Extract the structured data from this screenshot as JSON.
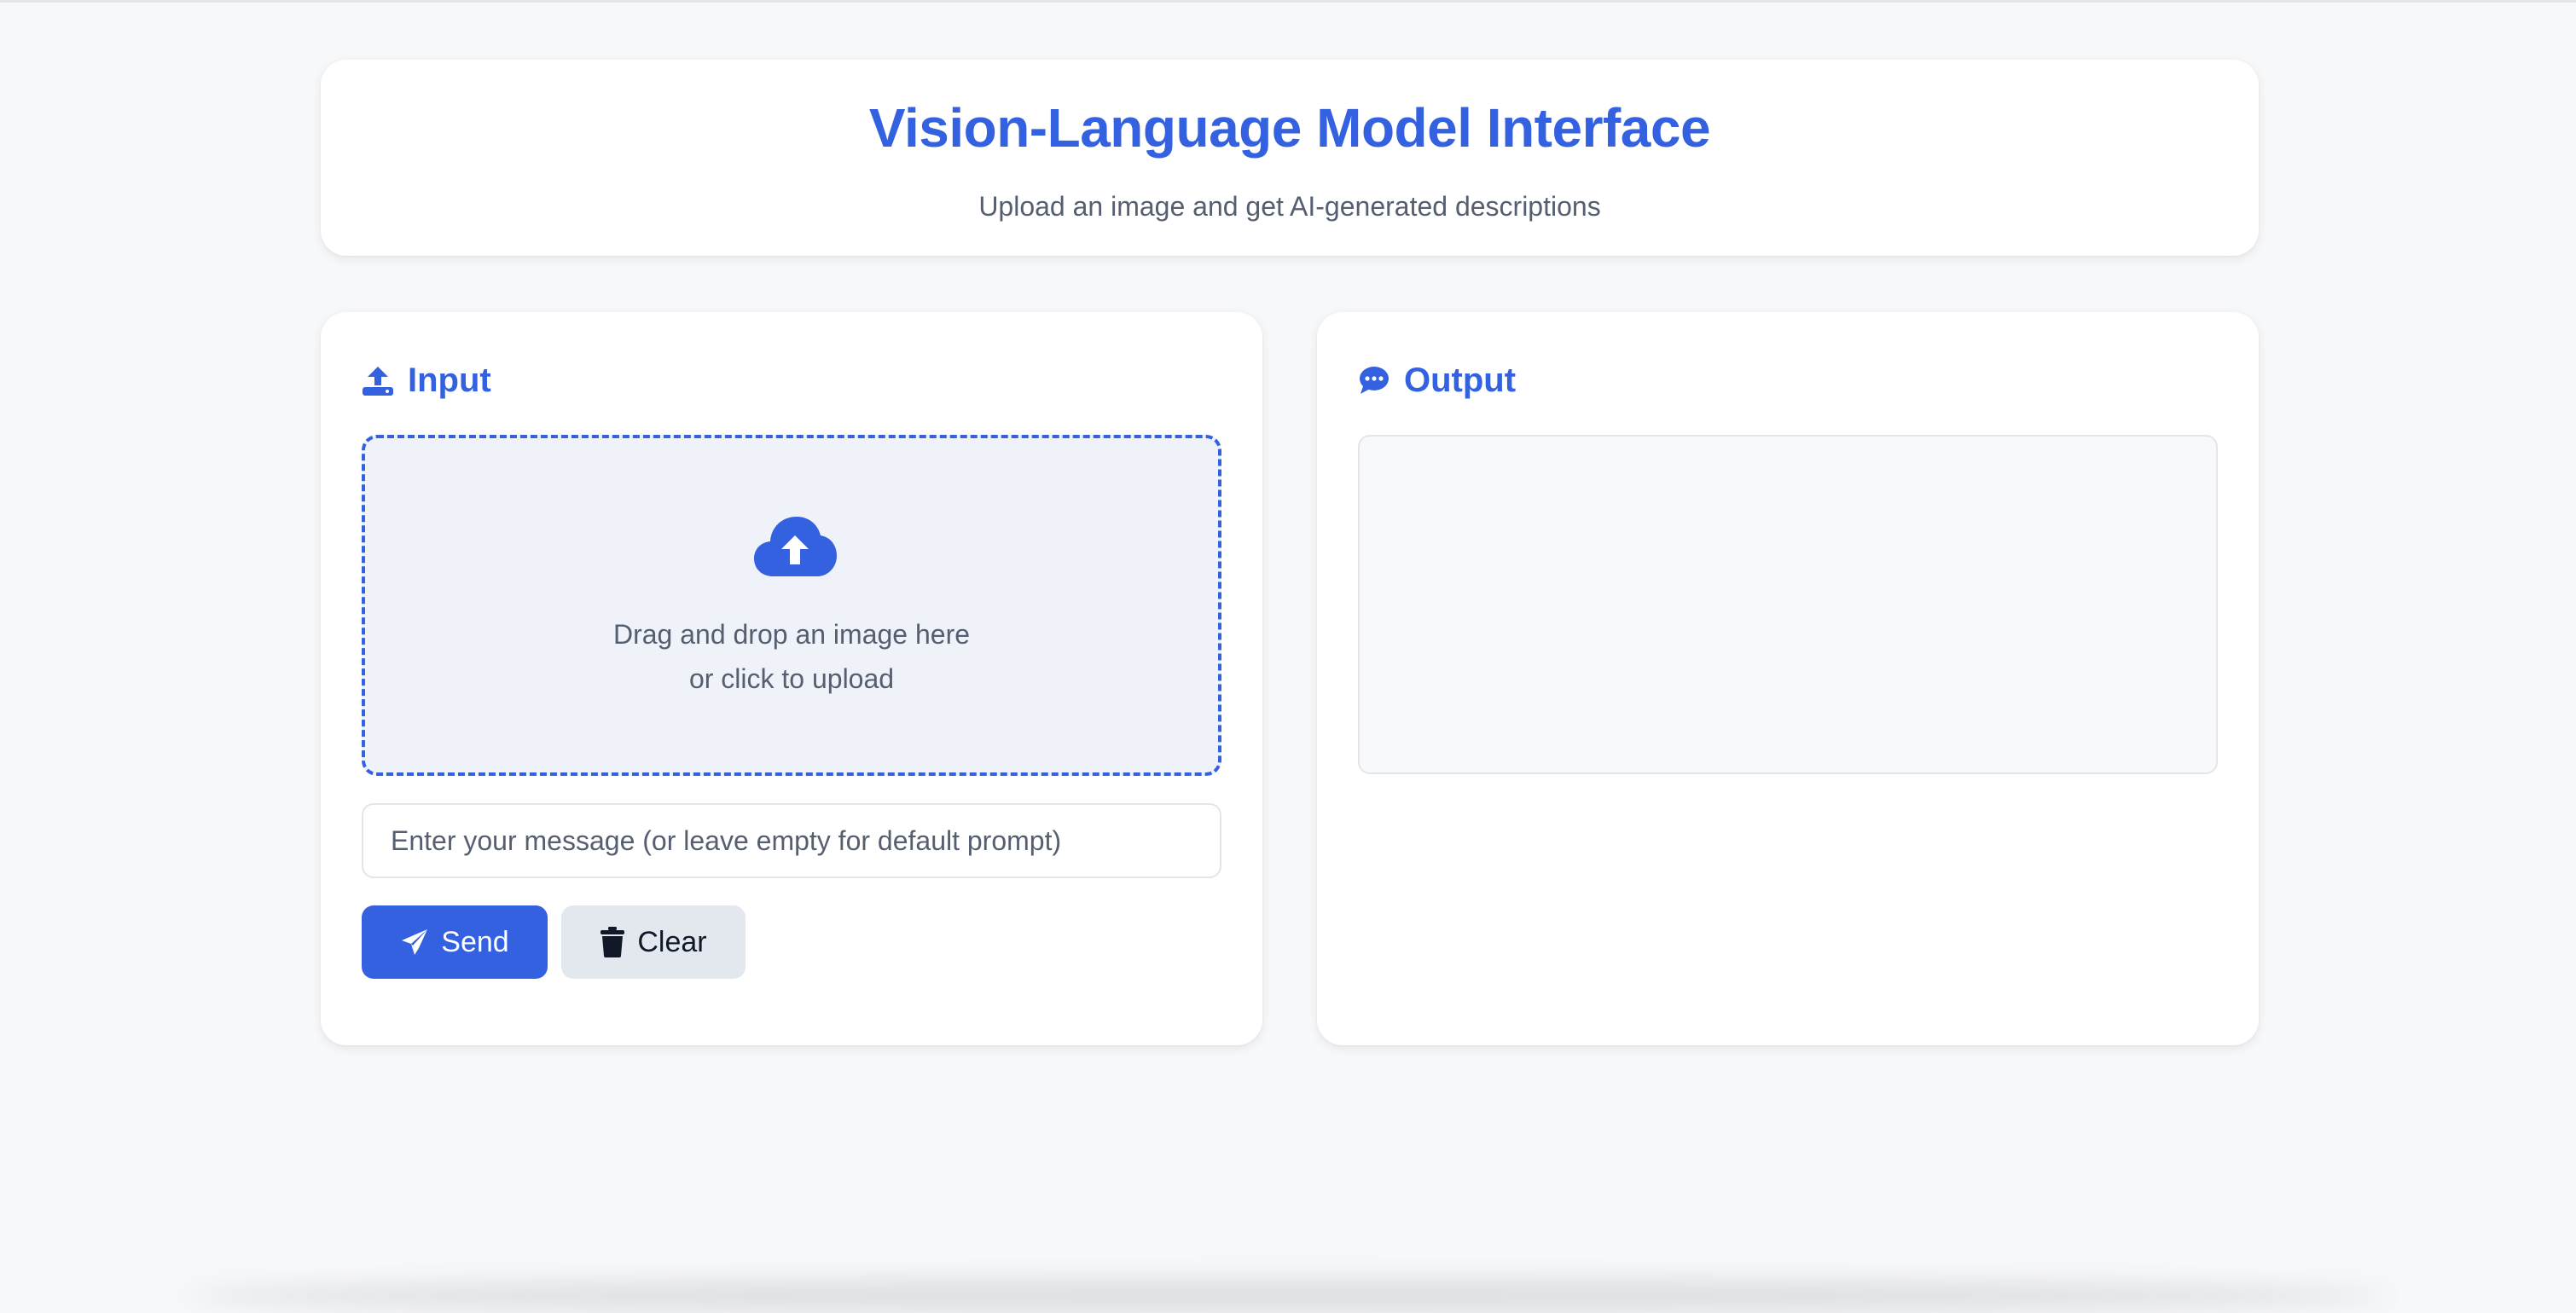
{
  "header": {
    "title": "Vision-Language Model Interface",
    "subtitle": "Upload an image and get AI-generated descriptions"
  },
  "input_panel": {
    "heading": "Input",
    "heading_icon": "upload-icon",
    "dropzone": {
      "icon": "cloud-upload-icon",
      "line1": "Drag and drop an image here",
      "line2": "or click to upload"
    },
    "message_input": {
      "value": "",
      "placeholder": "Enter your message (or leave empty for default prompt)"
    },
    "send_button": {
      "label": "Send",
      "icon": "paper-plane-icon"
    },
    "clear_button": {
      "label": "Clear",
      "icon": "trash-icon"
    }
  },
  "output_panel": {
    "heading": "Output",
    "heading_icon": "chat-bubble-icon",
    "content": ""
  },
  "colors": {
    "accent": "#3461e0",
    "page_background": "#f7f8fa",
    "card_background": "#ffffff",
    "dropzone_background": "#eff3f9",
    "muted_text": "#555f70",
    "clear_button_background": "#e3e7ee"
  }
}
